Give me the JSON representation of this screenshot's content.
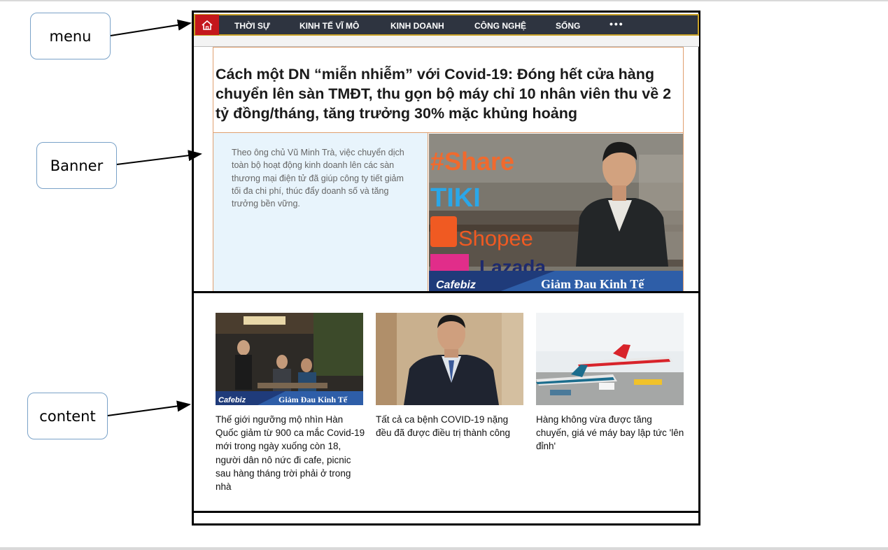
{
  "callouts": {
    "menu": "menu",
    "banner": "Banner",
    "content": "content"
  },
  "nav": {
    "items": [
      "THỜI SỰ",
      "KINH TẾ VĨ MÔ",
      "KINH DOANH",
      "CÔNG NGHỆ",
      "SỐNG"
    ],
    "more": "•••"
  },
  "banner": {
    "headline": "Cách một DN “miễn nhiễm” với Covid-19: Đóng hết cửa hàng chuyển lên sàn TMĐT, thu gọn bộ máy chỉ 10 nhân viên thu về 2 tỷ đồng/tháng, tăng trưởng 30% mặc khủng hoảng",
    "summary": "Theo ông chủ Vũ Minh Trà, việc chuyển dịch toàn bộ hoạt động kinh doanh lên các sàn thương mại điện tử đã giúp công ty tiết giảm tối đa chi phí, thúc đẩy doanh số và tăng trưởng bền vững.",
    "image_text": {
      "tag": "#Share",
      "brand1": "TIKI",
      "brand2": "Shopee",
      "brand3": "Lazada",
      "footer_left": "Cafebiz",
      "footer_right": "Giảm Đau Kinh Tế"
    }
  },
  "content": {
    "articles": [
      {
        "title": "Thế giới ngưỡng mộ nhìn Hàn Quốc giảm từ 900 ca mắc Covid-19 mới trong ngày xuống còn 18, người dân nô nức đi cafe, picnic sau hàng tháng trời phải ở trong nhà",
        "img_footer_left": "Cafebiz",
        "img_footer_right": "Giảm Đau Kinh Tế"
      },
      {
        "title": "Tất cả ca bệnh COVID-19 nặng đều đã được điều trị thành công"
      },
      {
        "title": "Hàng không vừa được tăng chuyến, giá vé máy bay lập tức 'lên đỉnh'"
      }
    ]
  },
  "colors": {
    "nav_bg": "#2e3440",
    "nav_border": "#c9a227",
    "home_red": "#c4171c",
    "banner_border": "#e0a070",
    "summary_bg": "#e8f4fc",
    "callout_border": "#7aa2c8"
  }
}
